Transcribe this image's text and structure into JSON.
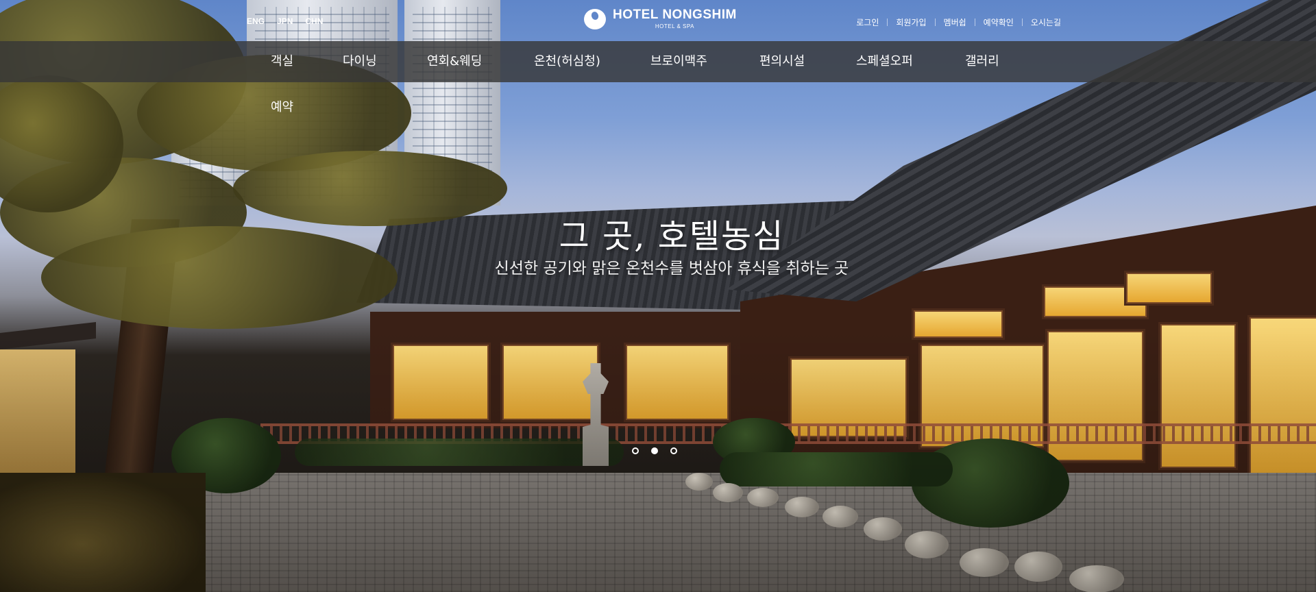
{
  "header": {
    "languages": [
      "ENG",
      "JPN",
      "CHN"
    ],
    "logo": {
      "name": "HOTEL NONGSHIM",
      "tagline": "HOTEL & SPA"
    },
    "utility_links": [
      "로그인",
      "회원가입",
      "멤버쉽",
      "예약확인",
      "오시는길"
    ]
  },
  "nav": {
    "items": [
      "객실",
      "다이닝",
      "연회&웨딩",
      "온천(허심청)",
      "브로이맥주",
      "편의시설",
      "스페셜오퍼",
      "갤러리",
      "예약"
    ]
  },
  "hero": {
    "title": "그 곳, 호텔농심",
    "subtitle": "신선한 공기와 맑은 온천수를 벗삼아 휴식을 취하는 곳"
  },
  "slider": {
    "slide_count": 3,
    "active_slide": 2
  }
}
